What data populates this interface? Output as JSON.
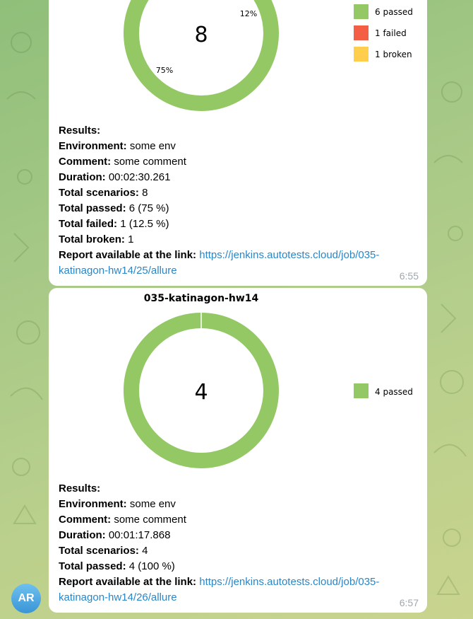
{
  "messages": [
    {
      "chart_data": {
        "type": "pie",
        "center_label": "8",
        "slices": [
          {
            "label": "passed",
            "value": 6,
            "color": "#93c865"
          },
          {
            "label": "failed",
            "value": 1,
            "color": "#f45e45"
          },
          {
            "label": "broken",
            "value": 1,
            "color": "#fece4c"
          }
        ],
        "visible_pct_labels": [
          "12%",
          "75%"
        ],
        "legend": [
          "6 passed",
          "1 failed",
          "1 broken"
        ],
        "legend_position": "right"
      },
      "caption": {
        "results": "Results:",
        "environment_label": "Environment:",
        "environment_value": "some env",
        "comment_label": "Comment:",
        "comment_value": "some comment",
        "duration_label": "Duration:",
        "duration_value": "00:02:30.261",
        "total_scenarios_label": "Total scenarios:",
        "total_scenarios_value": "8",
        "total_passed_label": "Total passed:",
        "total_passed_value": "6 (75 %)",
        "total_failed_label": "Total failed:",
        "total_failed_value": "1 (12.5 %)",
        "total_broken_label": "Total broken:",
        "total_broken_value": "1",
        "report_label": "Report available at the link:",
        "report_link": "https://jenkins.autotests.cloud/job/035-katinagon-hw14/25/allure"
      },
      "time": "6:55"
    },
    {
      "chart_data": {
        "type": "pie",
        "title": "035-katinagon-hw14",
        "center_label": "4",
        "slices": [
          {
            "label": "passed",
            "value": 4,
            "color": "#93c865"
          }
        ],
        "legend": [
          "4 passed"
        ],
        "legend_position": "right"
      },
      "caption": {
        "results": "Results:",
        "environment_label": "Environment:",
        "environment_value": "some env",
        "comment_label": "Comment:",
        "comment_value": "some comment",
        "duration_label": "Duration:",
        "duration_value": "00:01:17.868",
        "total_scenarios_label": "Total scenarios:",
        "total_scenarios_value": "4",
        "total_passed_label": "Total passed:",
        "total_passed_value": "4 (100 %)",
        "report_label": "Report available at the link:",
        "report_link": "https://jenkins.autotests.cloud/job/035-katinagon-hw14/26/allure"
      },
      "time": "6:57"
    }
  ],
  "avatar": {
    "initials": "AR",
    "color": "#3a95d6"
  }
}
